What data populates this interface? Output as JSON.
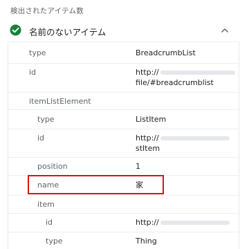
{
  "page_title": "検出されたアイテム数",
  "item": {
    "title": "名前のないアイテム",
    "status_icon": "check-circle-icon",
    "collapse_icon": "chevron-up-icon",
    "status_color": "#188038",
    "highlight_color": "#e01010"
  },
  "rows": [
    {
      "key": "type",
      "value": "BreadcrumbList"
    },
    {
      "key": "id",
      "value_line1": "http://",
      "value_line2": "file/#breadcrumblist"
    },
    {
      "key": "itemListElement"
    },
    {
      "key": "type",
      "value": "ListItem"
    },
    {
      "key": "id",
      "value_line1": "http://",
      "value_line2": "stItem"
    },
    {
      "key": "position",
      "value": "1"
    },
    {
      "key": "name",
      "value": "家"
    },
    {
      "key": "item"
    },
    {
      "key": "id",
      "value": "http://"
    },
    {
      "key": "type",
      "value": "Thing"
    }
  ]
}
